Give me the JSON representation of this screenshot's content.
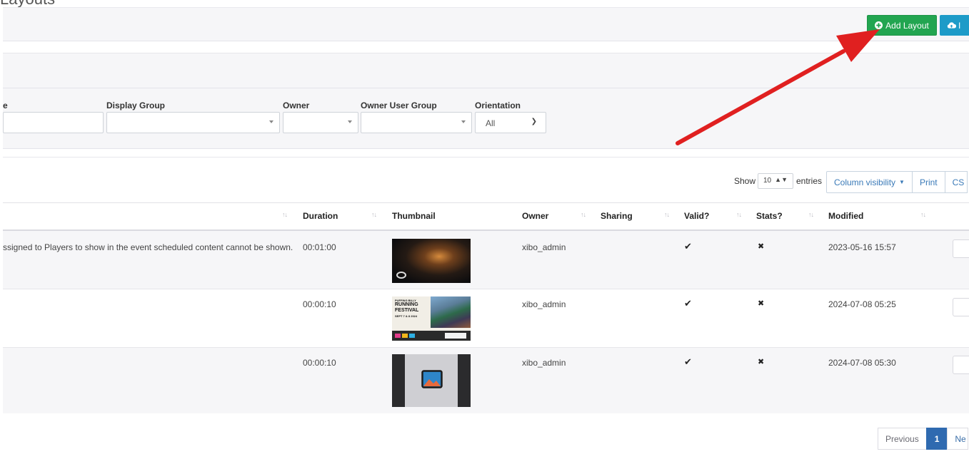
{
  "page": {
    "title_fragment": "Layouts"
  },
  "actions": {
    "add_layout_label": "Add Layout",
    "import_label": "I"
  },
  "filters": {
    "name_label": "e",
    "display_group_label": "Display Group",
    "owner_label": "Owner",
    "owner_user_group_label": "Owner User Group",
    "orientation_label": "Orientation",
    "orientation_value": "All"
  },
  "table_controls": {
    "show_label": "Show",
    "show_value": "10",
    "entries_label": "entries",
    "column_visibility_label": "Column visibility",
    "print_label": "Print",
    "csv_label": "CS"
  },
  "table": {
    "headers": [
      "Duration",
      "Thumbnail",
      "Owner",
      "Sharing",
      "Valid?",
      "Stats?",
      "Modified"
    ],
    "rows": [
      {
        "description": "ssigned to Players to show in the event scheduled content cannot be shown.",
        "duration": "00:01:00",
        "owner": "xibo_admin",
        "valid": "✔",
        "stats": "✖",
        "modified": "2023-05-16 15:57"
      },
      {
        "description": "",
        "duration": "00:00:10",
        "owner": "xibo_admin",
        "valid": "✔",
        "stats": "✖",
        "modified": "2024-07-08 05:25"
      },
      {
        "description": "",
        "duration": "00:00:10",
        "owner": "xibo_admin",
        "valid": "✔",
        "stats": "✖",
        "modified": "2024-07-08 05:30"
      }
    ]
  },
  "thumbnails": {
    "festival_line1": "PUFFING BILLY",
    "festival_line2": "RUNNING",
    "festival_line3": "FESTIVAL",
    "festival_line4": "SEPT 7 & 8 2024"
  },
  "pagination": {
    "previous_label": "Previous",
    "current_page": "1",
    "next_label": "Ne"
  },
  "colors": {
    "add_button": "#22a550",
    "import_button": "#1d9bc8",
    "active_page": "#2f6ab0",
    "annotation_arrow": "#e02020"
  },
  "icons": {
    "add_layout": "plus-circle-icon",
    "import": "cloud-upload-icon",
    "valid": "check-icon",
    "stats": "x-icon"
  }
}
